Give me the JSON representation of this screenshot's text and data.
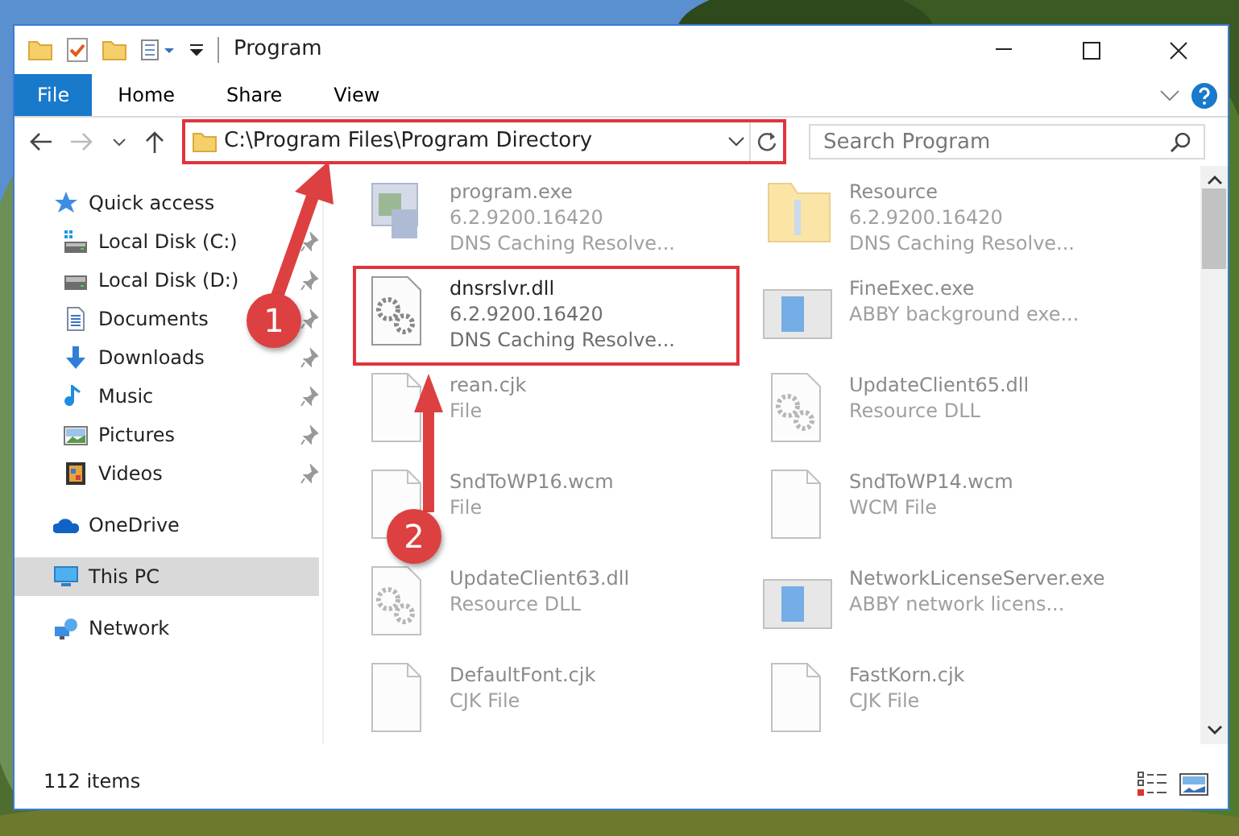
{
  "window": {
    "title": "Program"
  },
  "ribbon_tabs": [
    {
      "label": "File",
      "kind": "file",
      "selected": false
    },
    {
      "label": "Home",
      "kind": "tab",
      "selected": false
    },
    {
      "label": "Share",
      "kind": "tab",
      "selected": false
    },
    {
      "label": "View",
      "kind": "tab",
      "selected": false
    }
  ],
  "address_bar": {
    "path": "C:\\Program Files\\Program Directory",
    "highlighted": true
  },
  "search": {
    "placeholder": "Search Program"
  },
  "sidebar": {
    "items": [
      {
        "label": "Quick access",
        "selected": false,
        "children": [
          {
            "label": "Local Disk (C:)",
            "pinned": true,
            "selected": false
          },
          {
            "label": "Local Disk (D:)",
            "pinned": true,
            "selected": false
          },
          {
            "label": "Documents",
            "pinned": true,
            "selected": false
          },
          {
            "label": "Downloads",
            "pinned": true,
            "selected": false
          },
          {
            "label": "Music",
            "pinned": true,
            "selected": false
          },
          {
            "label": "Pictures",
            "pinned": true,
            "selected": false
          },
          {
            "label": "Videos",
            "pinned": true,
            "selected": false
          }
        ]
      },
      {
        "label": "OneDrive",
        "selected": false
      },
      {
        "label": "This PC",
        "selected": true
      },
      {
        "label": "Network",
        "selected": false
      }
    ]
  },
  "files": [
    {
      "name": "program.exe",
      "details": [
        "6.2.9200.16420",
        "DNS Caching Resolve..."
      ],
      "kind": "program",
      "dimmed": true,
      "highlighted": false
    },
    {
      "name": "Resource",
      "details": [
        "6.2.9200.16420",
        "DNS Caching Resolve..."
      ],
      "kind": "folder",
      "dimmed": true,
      "highlighted": false
    },
    {
      "name": "dnsrslvr.dll",
      "details": [
        "6.2.9200.16420",
        "DNS Caching Resolve..."
      ],
      "kind": "dll",
      "dimmed": false,
      "highlighted": true
    },
    {
      "name": "FineExec.exe",
      "details": [
        "ABBY background exe..."
      ],
      "kind": "window",
      "dimmed": true,
      "highlighted": false
    },
    {
      "name": "rean.cjk",
      "details": [
        "File"
      ],
      "kind": "file",
      "dimmed": true,
      "highlighted": false
    },
    {
      "name": "UpdateClient65.dll",
      "details": [
        "Resource DLL"
      ],
      "kind": "dll",
      "dimmed": true,
      "highlighted": false
    },
    {
      "name": "SndToWP16.wcm",
      "details": [
        "File"
      ],
      "kind": "file",
      "dimmed": true,
      "highlighted": false
    },
    {
      "name": "SndToWP14.wcm",
      "details": [
        "WCM File"
      ],
      "kind": "file",
      "dimmed": true,
      "highlighted": false
    },
    {
      "name": "UpdateClient63.dll",
      "details": [
        "Resource DLL"
      ],
      "kind": "dll",
      "dimmed": true,
      "highlighted": false
    },
    {
      "name": "NetworkLicenseServer.exe",
      "details": [
        "ABBY network licens..."
      ],
      "kind": "window",
      "dimmed": true,
      "highlighted": false
    },
    {
      "name": "DefaultFont.cjk",
      "details": [
        "CJK File"
      ],
      "kind": "file",
      "dimmed": true,
      "highlighted": false
    },
    {
      "name": "FastKorn.cjk",
      "details": [
        "CJK File"
      ],
      "kind": "file",
      "dimmed": true,
      "highlighted": false
    }
  ],
  "status_bar": {
    "item_count": "112 items"
  },
  "callouts": [
    {
      "number": "1"
    },
    {
      "number": "2"
    }
  ]
}
